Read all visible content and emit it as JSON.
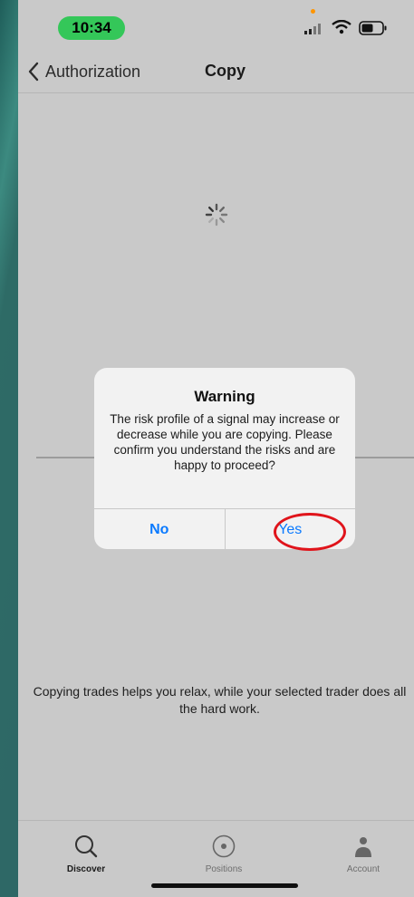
{
  "status_bar": {
    "time": "10:34",
    "icons": [
      "signal-icon",
      "wifi-icon",
      "battery-icon"
    ]
  },
  "nav": {
    "back_label": "Authorization",
    "title": "Copy"
  },
  "alert": {
    "title": "Warning",
    "message": "The risk profile of a signal may increase or decrease while you are copying.  Please confirm you understand the risks and are happy to proceed?",
    "no_label": "No",
    "yes_label": "Yes"
  },
  "tagline": "Copying trades helps you relax, while your selected trader does all the hard work.",
  "tabs": [
    {
      "label": "Discover",
      "icon": "search-icon",
      "active": true
    },
    {
      "label": "Positions",
      "icon": "positions-icon",
      "active": false
    },
    {
      "label": "Account",
      "icon": "person-icon",
      "active": false
    }
  ],
  "colors": {
    "accent": "#0a7aff",
    "highlight": "#e0141b",
    "time_pill": "#34c759",
    "screen_bg": "#c9c9c9"
  }
}
